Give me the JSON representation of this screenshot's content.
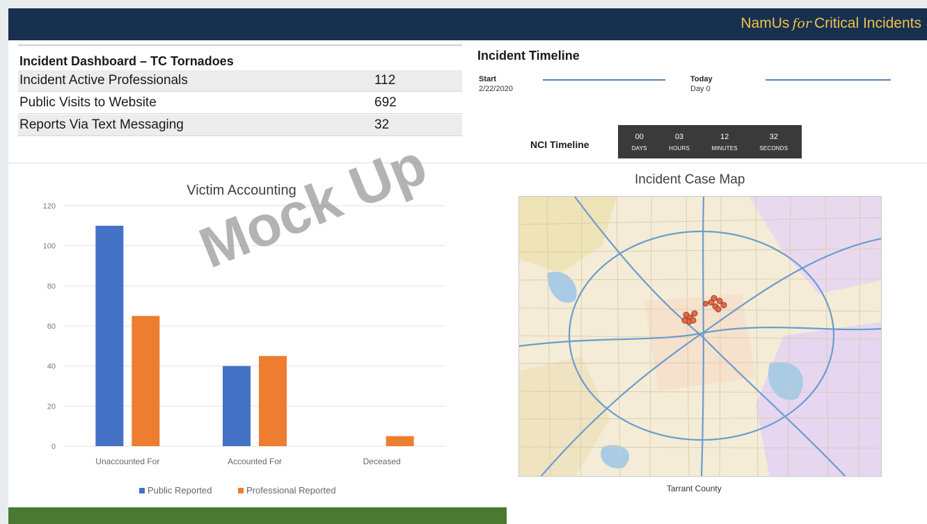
{
  "brand": {
    "prefix": "NamUs",
    "for": "for",
    "suffix": "Critical Incidents",
    "color": "#f0c24a",
    "bar_color": "#17304f"
  },
  "dashboard": {
    "title": "Incident Dashboard – TC Tornadoes",
    "rows": [
      {
        "label": "Incident Active Professionals",
        "value": "112"
      },
      {
        "label": "Public Visits to Website",
        "value": "692"
      },
      {
        "label": "Reports Via Text Messaging",
        "value": "32"
      }
    ]
  },
  "timeline": {
    "title": "Incident Timeline",
    "start_label": "Start",
    "start_date": "2/22/2020",
    "today_label": "Today",
    "today_day": "Day 0",
    "nci_label": "NCI Timeline",
    "counter": [
      {
        "value": "00",
        "unit": "DAYS"
      },
      {
        "value": "03",
        "unit": "HOURS"
      },
      {
        "value": "12",
        "unit": "MINUTES"
      },
      {
        "value": "32",
        "unit": "SECONDS"
      }
    ]
  },
  "map": {
    "title": "Incident Case Map",
    "caption": "Tarrant County"
  },
  "watermark": "Mock Up",
  "chart_data": {
    "type": "bar",
    "title": "Victim Accounting",
    "xlabel": "",
    "ylabel": "",
    "categories": [
      "Unaccounted For",
      "Accounted For",
      "Deceased"
    ],
    "series": [
      {
        "name": "Public Reported",
        "values": [
          110,
          40,
          0
        ],
        "color": "#4472c4"
      },
      {
        "name": "Professional Reported",
        "values": [
          65,
          45,
          5
        ],
        "color": "#ed7d31"
      }
    ],
    "ylim": [
      0,
      120
    ],
    "yticks": [
      0,
      20,
      40,
      60,
      80,
      100,
      120
    ],
    "grid": true,
    "legend": "bottom"
  }
}
